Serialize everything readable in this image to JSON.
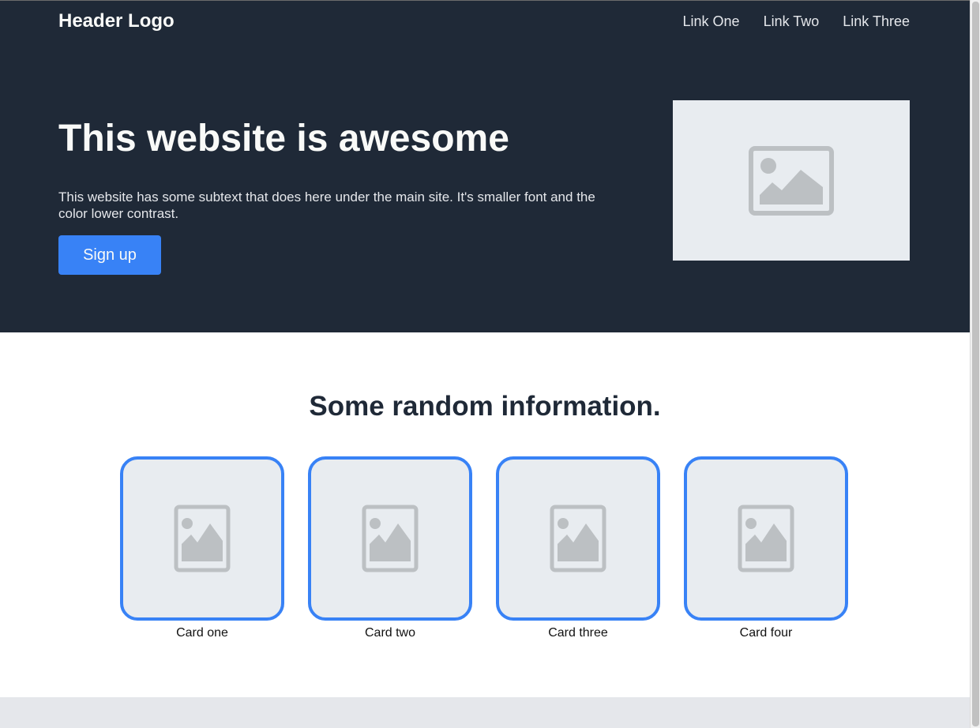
{
  "header": {
    "logo": "Header Logo",
    "nav_links": [
      "Link One",
      "Link Two",
      "Link Three"
    ]
  },
  "hero": {
    "title": "This website is awesome",
    "subtext": "This website has some subtext that does here under the main site. It's smaller font and the color lower contrast.",
    "button_label": "Sign up",
    "image_icon": "image-placeholder-icon"
  },
  "info": {
    "title": "Some random information.",
    "cards": [
      {
        "label": "Card one",
        "icon": "image-placeholder-icon"
      },
      {
        "label": "Card two",
        "icon": "image-placeholder-icon"
      },
      {
        "label": "Card three",
        "icon": "image-placeholder-icon"
      },
      {
        "label": "Card four",
        "icon": "image-placeholder-icon"
      }
    ]
  },
  "colors": {
    "header_bg": "#1f2937",
    "accent": "#3882f6",
    "placeholder_bg": "#e8ecf0",
    "placeholder_icon": "#bcc0c3",
    "footer_bg": "#e5e7eb"
  }
}
